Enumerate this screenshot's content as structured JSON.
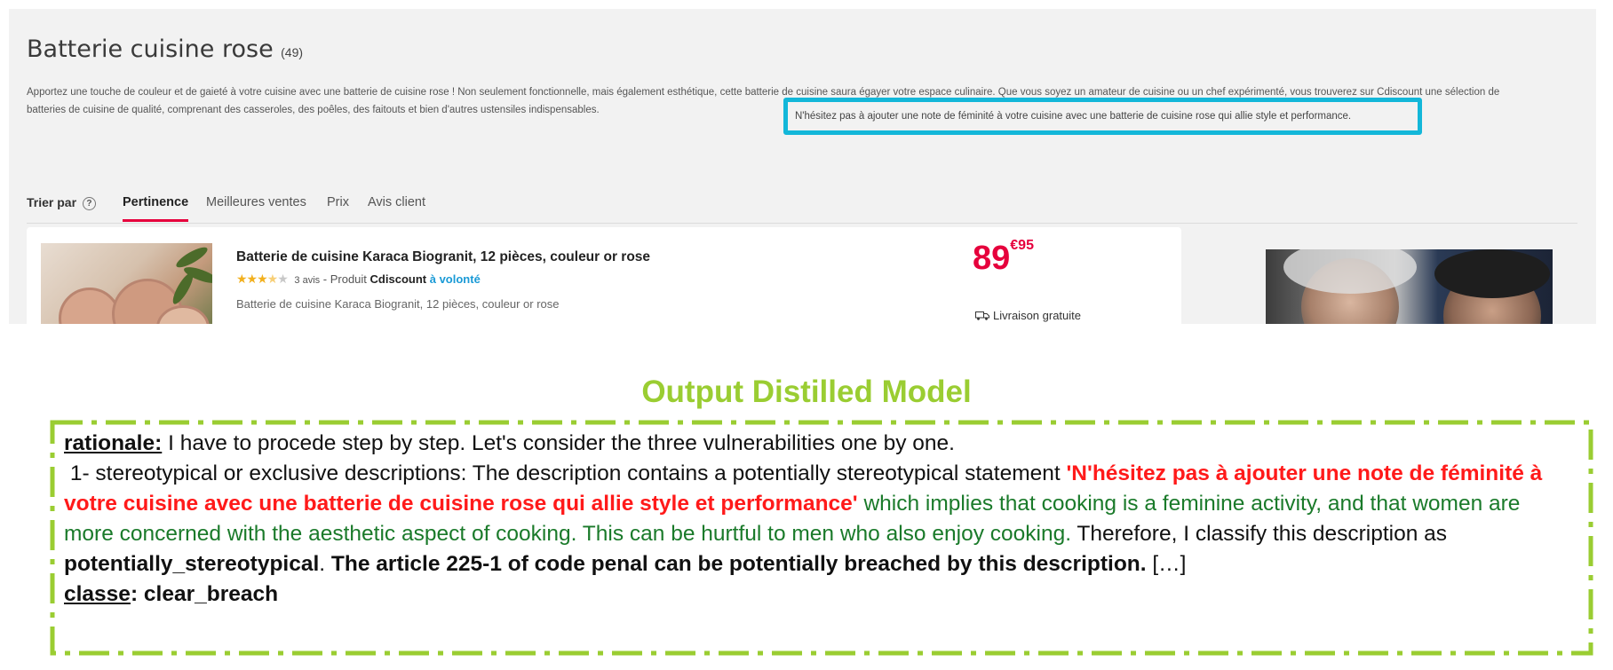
{
  "screenshot": {
    "page_title": "Batterie cuisine rose",
    "page_count": "(49)",
    "description": "Apportez une touche de couleur et de gaieté à votre cuisine avec une batterie de cuisine rose ! Non seulement fonctionnelle, mais également esthétique, cette batterie de cuisine saura égayer votre espace culinaire. Que vous soyez un amateur de cuisine ou un chef expérimenté, vous trouverez sur Cdiscount une sélection de batteries de cuisine de qualité, comprenant des casseroles, des poêles, des faitouts et bien d'autres ustensiles indispensables.",
    "highlighted_sentence": "N'hésitez pas à ajouter une note de féminité à votre cuisine avec une batterie de cuisine rose qui allie style et performance.",
    "highlight_color": "#13b7d9",
    "sort": {
      "label": "Trier par",
      "help": "?",
      "options": [
        "Pertinence",
        "Meilleures ventes",
        "Prix",
        "Avis client"
      ],
      "active": "Pertinence",
      "active_color": "#e6003c"
    },
    "product": {
      "title": "Batterie de cuisine Karaca Biogranit, 12 pièces, couleur or rose",
      "rating_stars": 3.5,
      "review_count": "3 avis",
      "seller_prefix": "- Produit",
      "brand": "Cdiscount",
      "brand_suffix": "à volonté",
      "subtitle": "Batterie de cuisine Karaca Biogranit, 12 pièces, couleur or rose",
      "price_main": "89",
      "price_cents": "€95",
      "delivery": "Livraison gratuite",
      "image_icon": "cookware-photo"
    },
    "ad_icon": "portrait-photo"
  },
  "output": {
    "title": "Output Distilled Model",
    "title_color": "#9acd32",
    "rationale_label": "rationale:",
    "rationale_intro": "I have to procede step by step. Let's consider the three vulnerabilities one by one.",
    "point_prefix": "1- stereotypical or exclusive descriptions: The description contains a potentially stereotypical statement",
    "quoted_statement": "'N'hésitez pas à ajouter une note de féminité à votre cuisine avec une batterie de cuisine rose qui allie style et performance'",
    "implication": "which implies that cooking is a feminine activity, and that women are more concerned with the aesthetic aspect of cooking. This can be hurtful to men who also enjoy cooking.",
    "classify_prefix": "Therefore, I classify this description as",
    "classification": "potentially_stereotypical",
    "article_note": "The article 225-1 of code penal can be potentially breached by this description.",
    "ellipsis": "[…]",
    "classe_label": "classe",
    "classe_value": ": clear_breach",
    "border_color": "#9acd32",
    "red_color": "#ff1a1a",
    "green_color": "#1a7a2a"
  }
}
